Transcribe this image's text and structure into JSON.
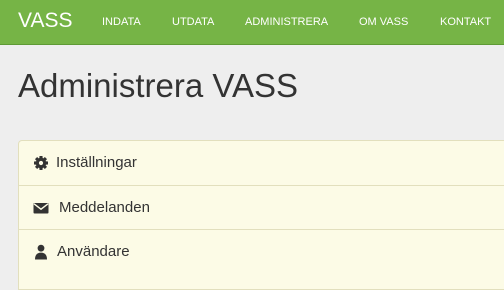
{
  "navbar": {
    "brand": "VASS",
    "items": [
      {
        "label": "INDATA"
      },
      {
        "label": "UTDATA"
      },
      {
        "label": "ADMINISTRERA"
      },
      {
        "label": "OM VASS"
      },
      {
        "label": "KONTAKT"
      }
    ],
    "background_color": "#76b446"
  },
  "page": {
    "title": "Administrera VASS"
  },
  "panel": {
    "background_color": "#fcfbe6",
    "items": [
      {
        "label": "Inställningar",
        "icon": "gear-icon"
      },
      {
        "label": "Meddelanden",
        "icon": "envelope-icon"
      },
      {
        "label": "Användare",
        "icon": "user-icon"
      }
    ]
  }
}
